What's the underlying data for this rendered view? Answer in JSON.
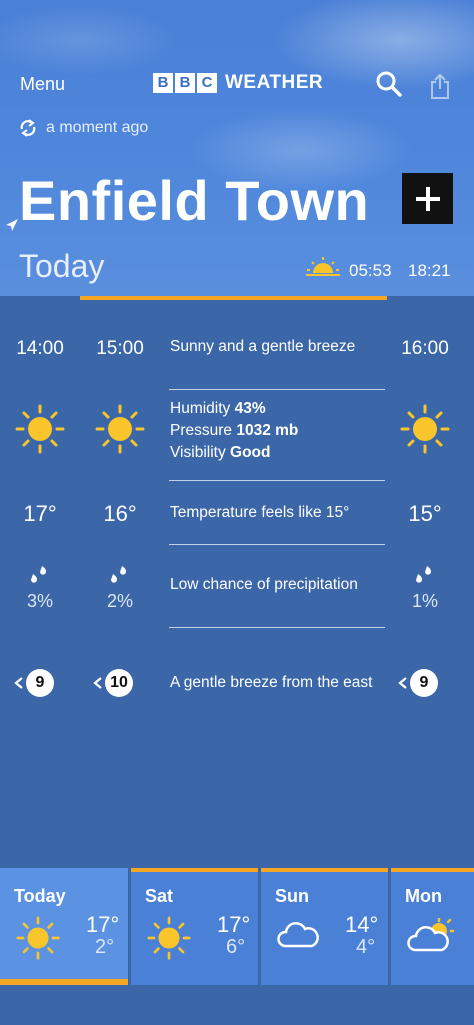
{
  "header": {
    "menu_label": "Menu",
    "logo_letters": [
      "B",
      "B",
      "C"
    ],
    "logo_text": "WEATHER",
    "updated_text": "a moment ago",
    "location": "Enfield Town",
    "day_title": "Today",
    "sunrise": "05:53",
    "sunset": "18:21"
  },
  "hours": [
    {
      "time": "14:00",
      "temp": "17°",
      "precip": "3%",
      "wind": "9"
    },
    {
      "time": "15:00",
      "temp": "16°",
      "precip": "2%",
      "wind": "10"
    },
    {
      "time": "16:00",
      "temp": "15°",
      "precip": "1%",
      "wind": "9"
    }
  ],
  "details": {
    "summary": "Sunny and a gentle breeze",
    "humidity_label": "Humidity",
    "humidity_value": "43%",
    "pressure_label": "Pressure",
    "pressure_value": "1032 mb",
    "visibility_label": "Visibility",
    "visibility_value": "Good",
    "feels_like": "Temperature feels like 15°",
    "precip_text": "Low chance of precipitation",
    "wind_text": "A gentle breeze from the east"
  },
  "days": [
    {
      "name": "Today",
      "high": "17°",
      "low": "2°",
      "icon": "sun-icon"
    },
    {
      "name": "Sat",
      "high": "17°",
      "low": "6°",
      "icon": "sun-icon"
    },
    {
      "name": "Sun",
      "high": "14°",
      "low": "4°",
      "icon": "cloud-icon"
    },
    {
      "name": "Mon",
      "high": "",
      "low": "",
      "icon": "sun-cloud-icon"
    }
  ],
  "colors": {
    "accent": "#f5a623",
    "sun": "#f9c52b",
    "panel": "#3b67a8",
    "sky": "#4a80d6"
  }
}
